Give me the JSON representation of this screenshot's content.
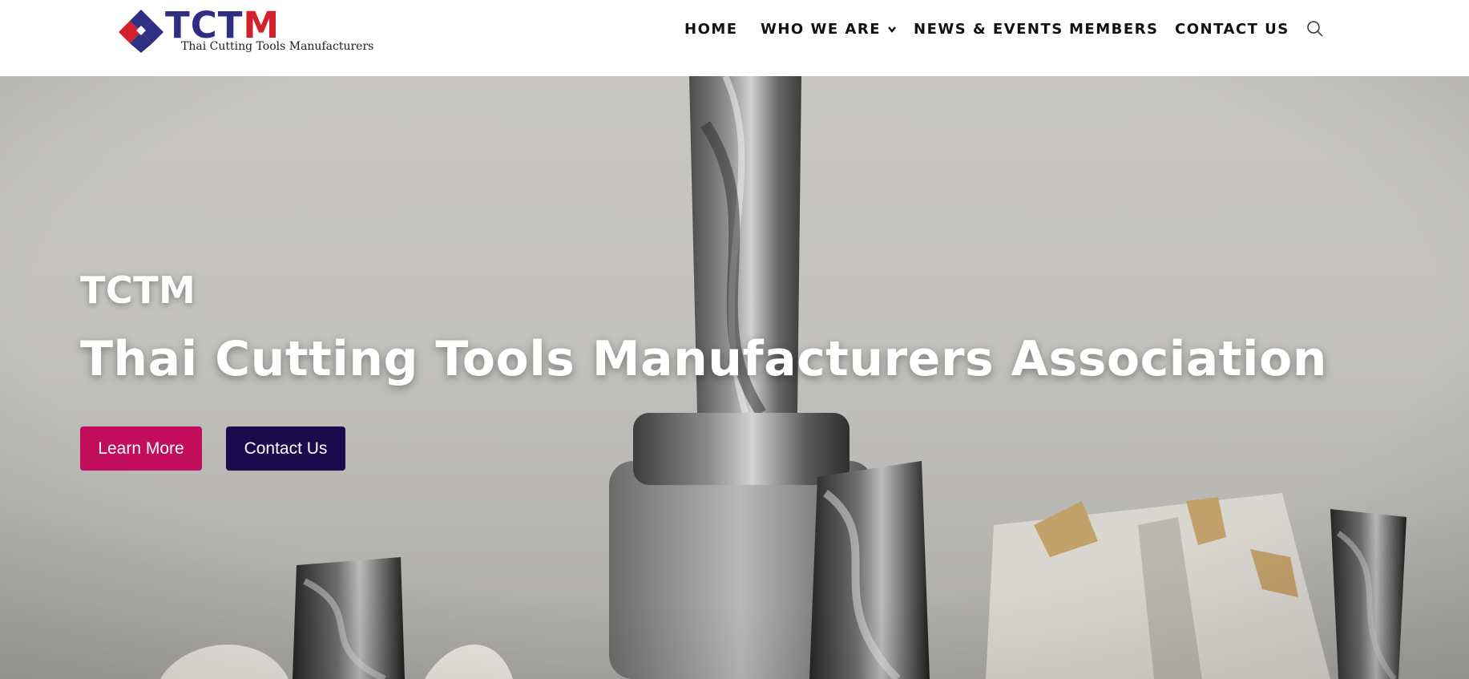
{
  "header": {
    "logo": {
      "wordmark_main": "TCT",
      "wordmark_accent": "M",
      "tagline": "Thai Cutting Tools Manufacturers",
      "colors": {
        "blue": "#2e2f83",
        "red": "#d3202a"
      }
    },
    "nav": [
      {
        "label": "HOME"
      },
      {
        "label": "WHO WE ARE",
        "has_dropdown": true
      },
      {
        "label": "NEWS & EVENTS"
      },
      {
        "label": "MEMBERS"
      },
      {
        "label": "CONTACT US"
      }
    ],
    "search_icon": "search-icon"
  },
  "hero": {
    "kicker": "TCTM",
    "title": "Thai Cutting Tools Manufacturers Association",
    "buttons": {
      "learn_more": "Learn More",
      "contact_us": "Contact Us"
    },
    "colors": {
      "learn_more_bg": "#c10d5b",
      "contact_us_bg": "#1a0b4f",
      "text": "#ffffff"
    }
  }
}
